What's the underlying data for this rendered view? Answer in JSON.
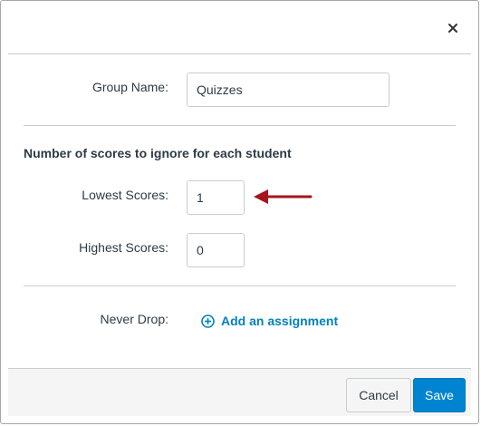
{
  "dialog": {
    "close_icon": "close-icon"
  },
  "group": {
    "name_label": "Group Name:",
    "name_value": "Quizzes"
  },
  "drop_rules": {
    "section_title": "Number of scores to ignore for each student",
    "lowest_label": "Lowest Scores:",
    "lowest_value": "1",
    "highest_label": "Highest Scores:",
    "highest_value": "0",
    "never_drop_label": "Never Drop:",
    "add_assignment_label": "Add an assignment",
    "add_icon": "plus-circle-icon"
  },
  "annotation": {
    "arrow_icon": "arrow-left-icon",
    "arrow_color": "#a4161a"
  },
  "footer": {
    "cancel_label": "Cancel",
    "save_label": "Save"
  },
  "colors": {
    "accent": "#0084d1",
    "link": "#0081bd"
  }
}
